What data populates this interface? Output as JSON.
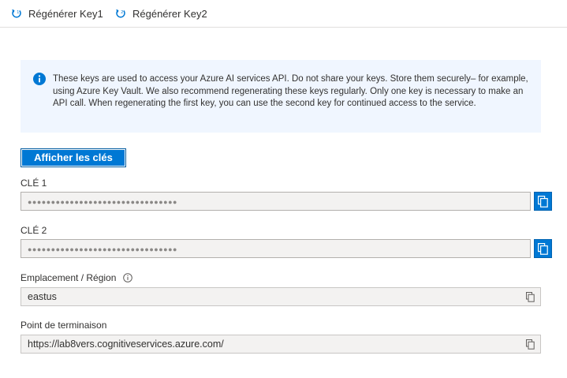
{
  "toolbar": {
    "regen_key1_label": "Régénérer Key1",
    "regen_key2_label": "Régénérer Key2"
  },
  "info": {
    "message": "These keys are used to access your Azure AI services API. Do not share your keys. Store them securely– for example, using Azure Key Vault. We also recommend regenerating these keys regularly. Only one key is necessary to make an API call. When regenerating the first key, you can use the second key for continued access to the service."
  },
  "show_keys_label": "Afficher les clés",
  "key1": {
    "label": "CLÉ 1",
    "masked_value": "●●●●●●●●●●●●●●●●●●●●●●●●●●●●●●●●"
  },
  "key2": {
    "label": "CLÉ 2",
    "masked_value": "●●●●●●●●●●●●●●●●●●●●●●●●●●●●●●●●"
  },
  "location": {
    "label": "Emplacement / Région",
    "value": "eastus"
  },
  "endpoint": {
    "label": "Point de terminaison",
    "value": "https://lab8vers.cognitiveservices.azure.com/"
  },
  "colors": {
    "accent": "#0078d4",
    "info_bg": "#f0f6ff",
    "field_bg": "#f3f2f1"
  },
  "icons": {
    "regen": "refresh-icon",
    "info": "info-icon",
    "copy": "copy-icon"
  }
}
